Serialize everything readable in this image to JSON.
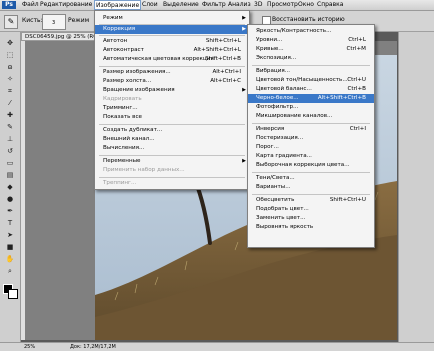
{
  "app": {
    "logo": "Ps"
  },
  "menubar": {
    "items": [
      "Файл",
      "Редактирование",
      "Изображение",
      "Слои",
      "Выделение",
      "Фильтр",
      "Анализ",
      "3D",
      "Просмотр",
      "Окно",
      "Справка"
    ]
  },
  "options": {
    "brush_label": "Кисть:",
    "brush_size": "3",
    "mode_label": "Режим",
    "restore_history": "Восстановить историю"
  },
  "document": {
    "tab_title": "DSC06459.jpg @ 25% (RGB/8",
    "zoom": "25%",
    "status_text": "Док: 17,2M/17,2M"
  },
  "image_menu": {
    "items": [
      {
        "label": "Режим",
        "shortcut": "",
        "arrow": true,
        "disabled": false
      },
      {
        "label": "Коррекция",
        "shortcut": "",
        "arrow": true,
        "disabled": false,
        "highlighted": true
      },
      {
        "label": "Автотон",
        "shortcut": "Shift+Ctrl+L",
        "arrow": false,
        "disabled": false
      },
      {
        "label": "Автоконтраст",
        "shortcut": "Alt+Shift+Ctrl+L",
        "arrow": false,
        "disabled": false
      },
      {
        "label": "Автоматическая цветовая коррекция",
        "shortcut": "Shift+Ctrl+B",
        "arrow": false,
        "disabled": false
      },
      {
        "label": "Размер изображения...",
        "shortcut": "Alt+Ctrl+I",
        "arrow": false,
        "disabled": false
      },
      {
        "label": "Размер холста...",
        "shortcut": "Alt+Ctrl+C",
        "arrow": false,
        "disabled": false
      },
      {
        "label": "Вращение изображения",
        "shortcut": "",
        "arrow": true,
        "disabled": false
      },
      {
        "label": "Кадрировать",
        "shortcut": "",
        "arrow": false,
        "disabled": true
      },
      {
        "label": "Тримминг...",
        "shortcut": "",
        "arrow": false,
        "disabled": false
      },
      {
        "label": "Показать все",
        "shortcut": "",
        "arrow": false,
        "disabled": false
      },
      {
        "label": "Создать дубликат...",
        "shortcut": "",
        "arrow": false,
        "disabled": false
      },
      {
        "label": "Внешний канал...",
        "shortcut": "",
        "arrow": false,
        "disabled": false
      },
      {
        "label": "Вычисления...",
        "shortcut": "",
        "arrow": false,
        "disabled": false
      },
      {
        "label": "Переменные",
        "shortcut": "",
        "arrow": true,
        "disabled": false
      },
      {
        "label": "Применить набор данных...",
        "shortcut": "",
        "arrow": false,
        "disabled": true
      },
      {
        "label": "Треппинг...",
        "shortcut": "",
        "arrow": false,
        "disabled": true
      }
    ]
  },
  "correction_menu": {
    "items": [
      {
        "label": "Яркость/Контрастность...",
        "shortcut": ""
      },
      {
        "label": "Уровни...",
        "shortcut": "Ctrl+L"
      },
      {
        "label": "Кривые...",
        "shortcut": "Ctrl+M"
      },
      {
        "label": "Экспозиция...",
        "shortcut": ""
      },
      {
        "label": "Вибрация...",
        "shortcut": ""
      },
      {
        "label": "Цветовой тон/Насыщенность...",
        "shortcut": "Ctrl+U"
      },
      {
        "label": "Цветовой баланс...",
        "shortcut": "Ctrl+B"
      },
      {
        "label": "Черно-белое...",
        "shortcut": "Alt+Shift+Ctrl+B",
        "highlighted": true
      },
      {
        "label": "Фотофильтр...",
        "shortcut": ""
      },
      {
        "label": "Микширование каналов...",
        "shortcut": ""
      },
      {
        "label": "Инверсия",
        "shortcut": "Ctrl+I"
      },
      {
        "label": "Постеризация...",
        "shortcut": ""
      },
      {
        "label": "Порог...",
        "shortcut": ""
      },
      {
        "label": "Карта градиента...",
        "shortcut": ""
      },
      {
        "label": "Выборочная коррекция цвета...",
        "shortcut": ""
      },
      {
        "label": "Тени/Света...",
        "shortcut": ""
      },
      {
        "label": "Варианты...",
        "shortcut": ""
      },
      {
        "label": "Обесцветить",
        "shortcut": "Shift+Ctrl+U"
      },
      {
        "label": "Подобрать цвет...",
        "shortcut": ""
      },
      {
        "label": "Заменить цвет...",
        "shortcut": ""
      },
      {
        "label": "Выровнять яркость",
        "shortcut": ""
      }
    ]
  },
  "tools": [
    "move-icon",
    "marquee-icon",
    "lasso-icon",
    "magic-wand-icon",
    "crop-icon",
    "eyedropper-icon",
    "healing-icon",
    "brush-icon",
    "stamp-icon",
    "history-brush-icon",
    "eraser-icon",
    "gradient-icon",
    "blur-icon",
    "dodge-icon",
    "pen-icon",
    "type-icon",
    "path-select-icon",
    "shape-icon",
    "hand-icon",
    "zoom-icon"
  ]
}
